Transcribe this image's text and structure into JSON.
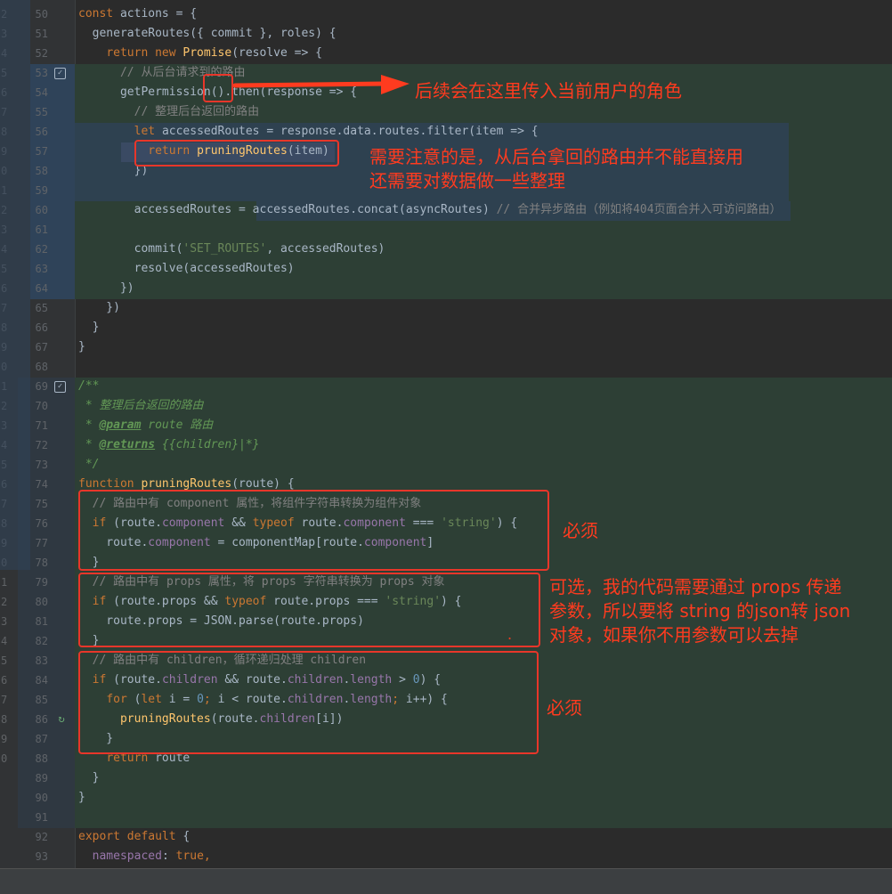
{
  "outer_gutter_numbers": [
    "2",
    "3",
    "4",
    "5",
    "6",
    "7",
    "8",
    "9",
    "0",
    "1",
    "2",
    "3",
    "4",
    "5",
    "6",
    "7",
    "8",
    "9",
    "0",
    "1",
    "2",
    "3",
    "4",
    "5",
    "6",
    "7",
    "8",
    "9",
    "0",
    "1",
    "2",
    "3",
    "4",
    "5",
    "6",
    "7",
    "8",
    "9",
    "0"
  ],
  "lines": [
    {
      "n": "50",
      "parts": [
        [
          "kw",
          "const "
        ],
        [
          "",
          "actions = {"
        ]
      ]
    },
    {
      "n": "51",
      "parts": [
        [
          "",
          "  "
        ],
        [
          "fn",
          ""
        ],
        [
          "",
          "generateRoutes({ commit }, roles) {"
        ]
      ]
    },
    {
      "n": "52",
      "parts": [
        [
          "",
          "    "
        ],
        [
          "kw",
          "return new "
        ],
        [
          "fn",
          "Promise"
        ],
        [
          "",
          "(resolve => {"
        ]
      ]
    },
    {
      "n": "53",
      "parts": [
        [
          "",
          "      "
        ],
        [
          "cm",
          "// 从后台请求到的路由"
        ]
      ]
    },
    {
      "n": "54",
      "parts": [
        [
          "",
          "      getPermission().then(response => {"
        ]
      ]
    },
    {
      "n": "55",
      "parts": [
        [
          "",
          "        "
        ],
        [
          "cm",
          "// 整理后台返回的路由"
        ]
      ]
    },
    {
      "n": "56",
      "parts": [
        [
          "",
          "        "
        ],
        [
          "kw",
          "let "
        ],
        [
          "",
          "accessedRoutes = response.data.routes.filter(item => {"
        ]
      ]
    },
    {
      "n": "57",
      "parts": [
        [
          "",
          "          "
        ],
        [
          "kw",
          "return "
        ],
        [
          "fn",
          "pruningRoutes"
        ],
        [
          "",
          "(item)"
        ]
      ]
    },
    {
      "n": "58",
      "parts": [
        [
          "",
          "        })"
        ]
      ]
    },
    {
      "n": "59",
      "parts": [
        [
          "",
          ""
        ]
      ]
    },
    {
      "n": "60",
      "parts": [
        [
          "",
          "        accessedRoutes = accessedRoutes.concat(asyncRoutes) "
        ],
        [
          "cm",
          "// 合并异步路由（例如将404页面合并入可访问路由）"
        ]
      ]
    },
    {
      "n": "61",
      "parts": [
        [
          "",
          ""
        ]
      ]
    },
    {
      "n": "62",
      "parts": [
        [
          "",
          "        commit("
        ],
        [
          "str",
          "'SET_ROUTES'"
        ],
        [
          "",
          ", accessedRoutes)"
        ]
      ]
    },
    {
      "n": "63",
      "parts": [
        [
          "",
          "        resolve(accessedRoutes)"
        ]
      ]
    },
    {
      "n": "64",
      "parts": [
        [
          "",
          "      })"
        ]
      ]
    },
    {
      "n": "65",
      "parts": [
        [
          "",
          "    })"
        ]
      ]
    },
    {
      "n": "66",
      "parts": [
        [
          "",
          "  }"
        ]
      ]
    },
    {
      "n": "67",
      "parts": [
        [
          "",
          "}"
        ]
      ]
    },
    {
      "n": "68",
      "parts": [
        [
          "",
          ""
        ]
      ]
    },
    {
      "n": "69",
      "parts": [
        [
          "cmt-doc",
          "/**"
        ]
      ]
    },
    {
      "n": "70",
      "parts": [
        [
          "cmt-doc",
          " * 整理后台返回的路由"
        ]
      ]
    },
    {
      "n": "71",
      "parts": [
        [
          "cmt-doc",
          " * "
        ],
        [
          "doc-tag",
          "@param"
        ],
        [
          "cmt-doc",
          " route 路由"
        ]
      ]
    },
    {
      "n": "72",
      "parts": [
        [
          "cmt-doc",
          " * "
        ],
        [
          "doc-tag",
          "@returns"
        ],
        [
          "cmt-doc",
          " {{children}|*}"
        ]
      ]
    },
    {
      "n": "73",
      "parts": [
        [
          "cmt-doc",
          " */"
        ]
      ]
    },
    {
      "n": "74",
      "parts": [
        [
          "kw",
          "function "
        ],
        [
          "fn",
          "pruningRoutes"
        ],
        [
          "",
          "(route) {"
        ]
      ]
    },
    {
      "n": "75",
      "parts": [
        [
          "",
          "  "
        ],
        [
          "cm",
          "// 路由中有 component 属性，将组件字符串转换为组件对象"
        ]
      ]
    },
    {
      "n": "76",
      "parts": [
        [
          "",
          "  "
        ],
        [
          "kw",
          "if "
        ],
        [
          "",
          "(route."
        ],
        [
          "prop",
          "component"
        ],
        [
          "",
          " && "
        ],
        [
          "kw",
          "typeof "
        ],
        [
          "",
          "route."
        ],
        [
          "prop",
          "component"
        ],
        [
          "",
          " === "
        ],
        [
          "str",
          "'string'"
        ],
        [
          "",
          ") {"
        ]
      ]
    },
    {
      "n": "77",
      "parts": [
        [
          "",
          "    route."
        ],
        [
          "prop",
          "component"
        ],
        [
          "",
          " = componentMap[route."
        ],
        [
          "prop",
          "component"
        ],
        [
          "",
          "]"
        ]
      ]
    },
    {
      "n": "78",
      "parts": [
        [
          "",
          "  }"
        ]
      ]
    },
    {
      "n": "79",
      "parts": [
        [
          "",
          "  "
        ],
        [
          "cm",
          "// 路由中有 props 属性，将 props 字符串转换为 props 对象"
        ]
      ]
    },
    {
      "n": "80",
      "parts": [
        [
          "",
          "  "
        ],
        [
          "kw",
          "if "
        ],
        [
          "",
          "(route.props && "
        ],
        [
          "kw",
          "typeof "
        ],
        [
          "",
          "route.props === "
        ],
        [
          "str",
          "'string'"
        ],
        [
          "",
          ") {"
        ]
      ]
    },
    {
      "n": "81",
      "parts": [
        [
          "",
          "    route.props = JSON.parse(route.props)"
        ]
      ]
    },
    {
      "n": "82",
      "parts": [
        [
          "",
          "  }"
        ]
      ]
    },
    {
      "n": "83",
      "parts": [
        [
          "",
          "  "
        ],
        [
          "cm",
          "// 路由中有 children，循环递归处理 children"
        ]
      ]
    },
    {
      "n": "84",
      "parts": [
        [
          "",
          "  "
        ],
        [
          "kw",
          "if "
        ],
        [
          "",
          "(route."
        ],
        [
          "prop",
          "children"
        ],
        [
          "",
          " && route."
        ],
        [
          "prop",
          "children"
        ],
        [
          "",
          "."
        ],
        [
          "prop",
          "length"
        ],
        [
          "",
          " > "
        ],
        [
          "num",
          "0"
        ],
        [
          "",
          ") {"
        ]
      ]
    },
    {
      "n": "85",
      "parts": [
        [
          "",
          "    "
        ],
        [
          "kw",
          "for "
        ],
        [
          "",
          "("
        ],
        [
          "kw",
          "let "
        ],
        [
          "",
          "i = "
        ],
        [
          "num",
          "0"
        ],
        [
          "kw",
          "; "
        ],
        [
          "",
          "i < route."
        ],
        [
          "prop",
          "children"
        ],
        [
          "",
          "."
        ],
        [
          "prop",
          "length"
        ],
        [
          "kw",
          "; "
        ],
        [
          "",
          "i++) {"
        ]
      ]
    },
    {
      "n": "86",
      "parts": [
        [
          "",
          "      "
        ],
        [
          "fn",
          "pruningRoutes"
        ],
        [
          "",
          "(route."
        ],
        [
          "prop",
          "children"
        ],
        [
          "",
          "[i])"
        ]
      ]
    },
    {
      "n": "87",
      "parts": [
        [
          "",
          "    }"
        ]
      ]
    },
    {
      "n": "88",
      "parts": [
        [
          "",
          "    "
        ],
        [
          "kw",
          "return "
        ],
        [
          "",
          "route"
        ]
      ]
    },
    {
      "n": "89",
      "parts": [
        [
          "",
          "  }"
        ]
      ]
    },
    {
      "n": "90",
      "parts": [
        [
          "",
          "}"
        ]
      ]
    },
    {
      "n": "91",
      "parts": [
        [
          "",
          ""
        ]
      ]
    },
    {
      "n": "92",
      "parts": [
        [
          "kw",
          "export default "
        ],
        [
          "",
          "{"
        ]
      ]
    },
    {
      "n": "93",
      "parts": [
        [
          "",
          "  "
        ],
        [
          "prop",
          "namespaced"
        ],
        [
          "",
          ": "
        ],
        [
          "kw",
          "true"
        ],
        [
          "kw",
          ","
        ]
      ]
    }
  ],
  "annotations": {
    "arrow_note": "后续会在这里传入当前用户的角色",
    "note_line1": "需要注意的是，从后台拿回的路由并不能直接用",
    "note_line2": "还需要对数据做一些整理",
    "required_1": "必须",
    "optional_line1": "可选，我的代码需要通过 props 传递",
    "optional_line2": "参数，所以要将 string 的json转 json",
    "optional_line3": "对象，如果你不用参数可以去掉",
    "required_2": "必须",
    "dot": "."
  },
  "colors": {
    "annotation_red": "#ff3b1f",
    "box_red": "#e8362a",
    "keyword": "#cc7832",
    "function": "#ffc66d",
    "string": "#6a8759",
    "comment": "#808080"
  }
}
